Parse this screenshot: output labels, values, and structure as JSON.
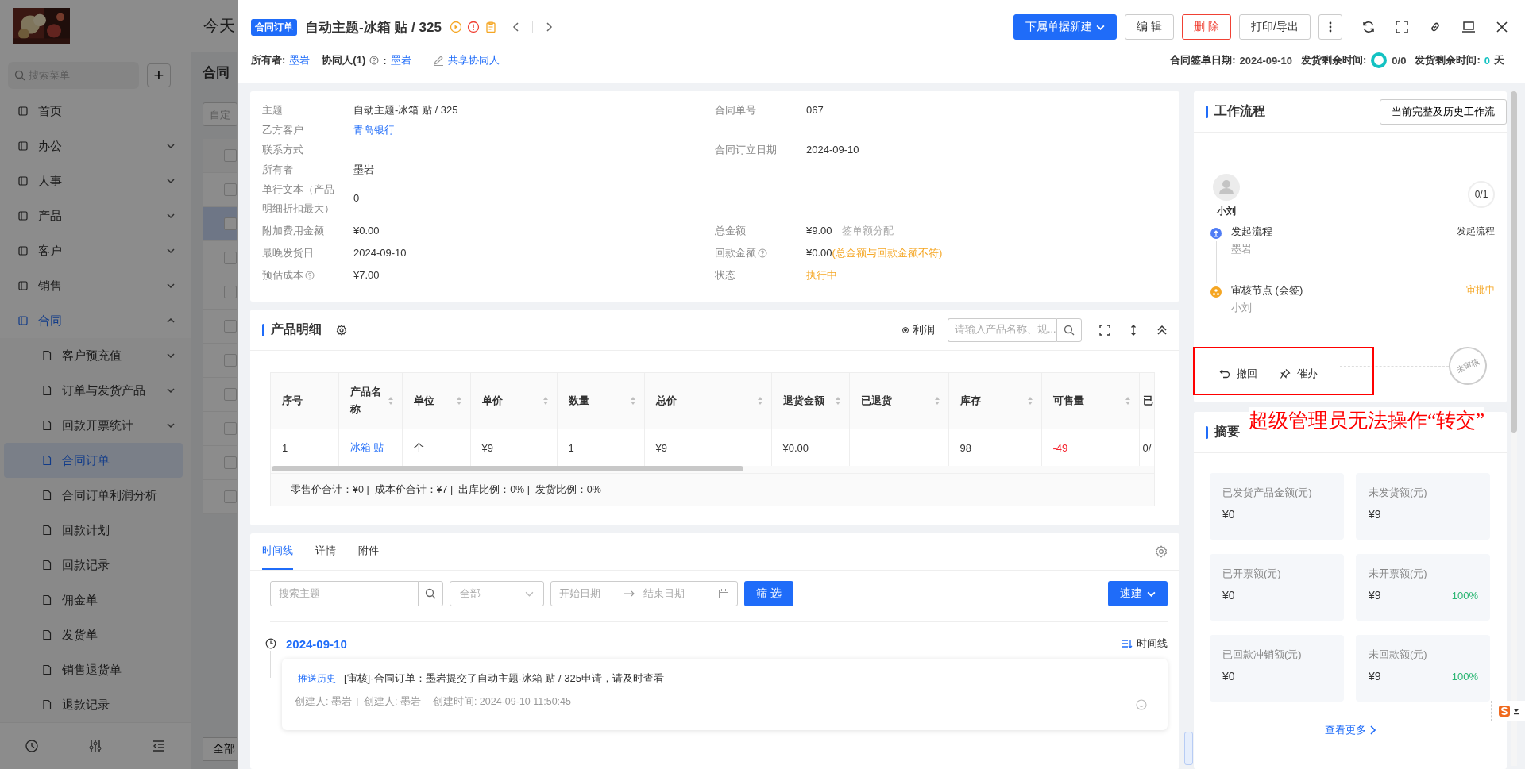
{
  "background": {
    "greeting": "今天",
    "search": {
      "placeholder": "搜索菜单"
    },
    "add_button": "+",
    "menu": [
      {
        "label": "首页",
        "selected": false
      },
      {
        "label": "办公",
        "selected": false,
        "expanded": false
      },
      {
        "label": "人事",
        "selected": false,
        "expanded": false
      },
      {
        "label": "产品",
        "selected": false,
        "expanded": false
      },
      {
        "label": "客户",
        "selected": false,
        "expanded": false
      },
      {
        "label": "销售",
        "selected": false,
        "expanded": false
      },
      {
        "label": "合同",
        "selected": false,
        "expanded": true,
        "children": [
          {
            "label": "客户预充值",
            "selected": false,
            "expanded": false
          },
          {
            "label": "订单与发货产品",
            "selected": false,
            "expanded": false
          },
          {
            "label": "回款开票统计",
            "selected": false,
            "expanded": false
          },
          {
            "label": "合同订单",
            "selected": true
          },
          {
            "label": "合同订单利润分析",
            "selected": false
          },
          {
            "label": "回款计划",
            "selected": false
          },
          {
            "label": "回款记录",
            "selected": false
          },
          {
            "label": "佣金单",
            "selected": false
          },
          {
            "label": "发货单",
            "selected": false
          },
          {
            "label": "销售退货单",
            "selected": false
          },
          {
            "label": "退款记录",
            "selected": false
          }
        ]
      }
    ],
    "page_title": "合同",
    "view_select": "自定",
    "header_check": {
      "checked": false
    },
    "rows": [
      {
        "selected": false,
        "checked": false
      },
      {
        "selected": true,
        "checked": false
      },
      {
        "selected": false,
        "checked": false
      },
      {
        "selected": false,
        "checked": false
      },
      {
        "selected": false,
        "checked": false
      },
      {
        "selected": false,
        "checked": false
      },
      {
        "selected": false,
        "checked": false
      },
      {
        "selected": false,
        "checked": false
      },
      {
        "selected": false,
        "checked": false
      },
      {
        "selected": false,
        "checked": false
      }
    ],
    "bottom_button": "全部"
  },
  "drawer": {
    "badge": "合同订单",
    "title": "自动主题-冰箱 贴 / 325",
    "actions": [
      {
        "label": "下属单据新建",
        "kind": "primary"
      },
      {
        "label": "编 辑",
        "kind": "default"
      },
      {
        "label": "删 除",
        "kind": "danger"
      },
      {
        "label": "打印/导出",
        "kind": "default"
      }
    ],
    "owner_label": "所有者:",
    "owner": "墨岩",
    "collab_label": "协同人(1)",
    "collab_sep": ":",
    "collab": "墨岩",
    "share": "共享协同人",
    "sign_date_label": "合同签单日期:",
    "sign_date": "2024-09-10",
    "ship_label": "发货剩余时间:",
    "ship_progress": "0/0",
    "ship_label_2": "发货剩余时间:",
    "ship_days": "0",
    "ship_unit": "天"
  },
  "info_rows": [
    {
      "left": {
        "label": "主题",
        "value": "自动主题-冰箱 贴 / 325",
        "kind": "plain"
      },
      "right": {
        "label": "合同单号",
        "value": "067",
        "kind": "plain"
      }
    },
    {
      "left": {
        "label": "乙方客户",
        "value": "青岛银行",
        "kind": "link"
      }
    },
    {
      "left": {
        "label": "联系方式"
      },
      "right": {
        "label": "合同订立日期",
        "value": "2024-09-10",
        "kind": "plain"
      }
    },
    {
      "left": {
        "label": "所有者",
        "value": "墨岩",
        "kind": "plain"
      }
    },
    {
      "left": {
        "label": "单行文本（产品明细折扣最大）",
        "value": "0",
        "kind": "plain"
      }
    },
    {
      "left": {
        "label": "附加费用金额",
        "value": "¥0.00",
        "kind": "plain"
      },
      "right": {
        "label": "总金额",
        "value": "¥9.00",
        "kind": "plain",
        "note": "签单额分配",
        "note_warning": false
      }
    },
    {
      "left": {
        "label": "最晚发货日",
        "value": "2024-09-10",
        "kind": "plain"
      },
      "right": {
        "label": "回款金额",
        "help": true,
        "value": "¥0.00",
        "kind": "plain",
        "note": "(总金额与回款金额不符)",
        "note_warning": true
      }
    },
    {
      "left": {
        "label": "预估成本",
        "help": true,
        "value": "¥7.00",
        "kind": "plain"
      },
      "right": {
        "label": "状态",
        "value": "执行中",
        "kind": "warning"
      }
    }
  ],
  "products": {
    "title": "产品明细",
    "profit": {
      "label": "利润",
      "checked": true
    },
    "search": {
      "placeholder": "请输入产品名称、规..."
    },
    "columns": [
      {
        "label": "序号",
        "sortable": false
      },
      {
        "label": "产品名称",
        "sortable": true
      },
      {
        "label": "单位",
        "sortable": true
      },
      {
        "label": "单价",
        "sortable": true
      },
      {
        "label": "数量",
        "sortable": true
      },
      {
        "label": "总价",
        "sortable": true
      },
      {
        "label": "退货金额",
        "sortable": true
      },
      {
        "label": "已退货",
        "sortable": true
      },
      {
        "label": "库存",
        "sortable": true
      },
      {
        "label": "可售量",
        "sortable": true
      },
      {
        "label": "已"
      }
    ],
    "rows": [
      [
        {
          "text": "1",
          "kind": "plain"
        },
        {
          "text": "冰箱 贴",
          "kind": "link"
        },
        {
          "text": "个",
          "kind": "plain"
        },
        {
          "text": "¥9",
          "kind": "plain"
        },
        {
          "text": "1",
          "kind": "plain"
        },
        {
          "text": "¥9",
          "kind": "plain"
        },
        {
          "text": "¥0.00",
          "kind": "plain"
        },
        {
          "text": "",
          "kind": "plain"
        },
        {
          "text": "98",
          "kind": "plain"
        },
        {
          "text": "-49",
          "kind": "negative"
        },
        {
          "text": "0/",
          "kind": "plain"
        }
      ]
    ],
    "footer": "零售价合计：¥0 |  成本价合计：¥7 |  出库比例：0% |  发货比例：0%"
  },
  "timeline": {
    "tabs": [
      {
        "label": "时间线",
        "selected": true
      },
      {
        "label": "详情",
        "selected": false
      },
      {
        "label": "附件",
        "selected": false
      }
    ],
    "search": {
      "placeholder": "搜索主题"
    },
    "type_select": "全部",
    "start": {
      "placeholder": "开始日期"
    },
    "end": {
      "placeholder": "结束日期"
    },
    "filter_button": "筛 选",
    "quick_button": "速建",
    "date": "2024-09-10",
    "sort": "时间线",
    "entries": [
      {
        "tag": "推送历史",
        "text": "[审核]-合同订单：墨岩提交了自动主题-冰箱 贴 / 325申请，请及时查看",
        "meta": [
          "创建人: 墨岩",
          "创建人: 墨岩",
          "创建时间: 2024-09-10 11:50:45"
        ]
      }
    ]
  },
  "workflow": {
    "title": "工作流程",
    "history_button": "当前完整及历史工作流",
    "approver": "小刘",
    "progress": "0/1",
    "steps": [
      {
        "title": "发起流程",
        "person": "墨岩",
        "status": "发起流程",
        "kind": "start"
      },
      {
        "title": "审核节点 (会签)",
        "person": "小刘",
        "status": "审批中",
        "kind": "review"
      }
    ],
    "stamp": "未审核",
    "actions": [
      {
        "label": "撤回",
        "kind": "undo"
      },
      {
        "label": "催办",
        "kind": "pin"
      }
    ]
  },
  "annotation": "超级管理员无法操作“转交”",
  "summary": {
    "title": "摘要",
    "tiles": [
      {
        "label": "已发货产品金额(元)",
        "value": "¥0"
      },
      {
        "label": "未发货额(元)",
        "value": "¥9"
      },
      {
        "label": "已开票额(元)",
        "value": "¥0"
      },
      {
        "label": "未开票额(元)",
        "value": "¥9",
        "percent": "100%"
      },
      {
        "label": "已回款冲销额(元)",
        "value": "¥0"
      },
      {
        "label": "未回款额(元)",
        "value": "¥9",
        "percent": "100%"
      }
    ],
    "more": "查看更多"
  }
}
